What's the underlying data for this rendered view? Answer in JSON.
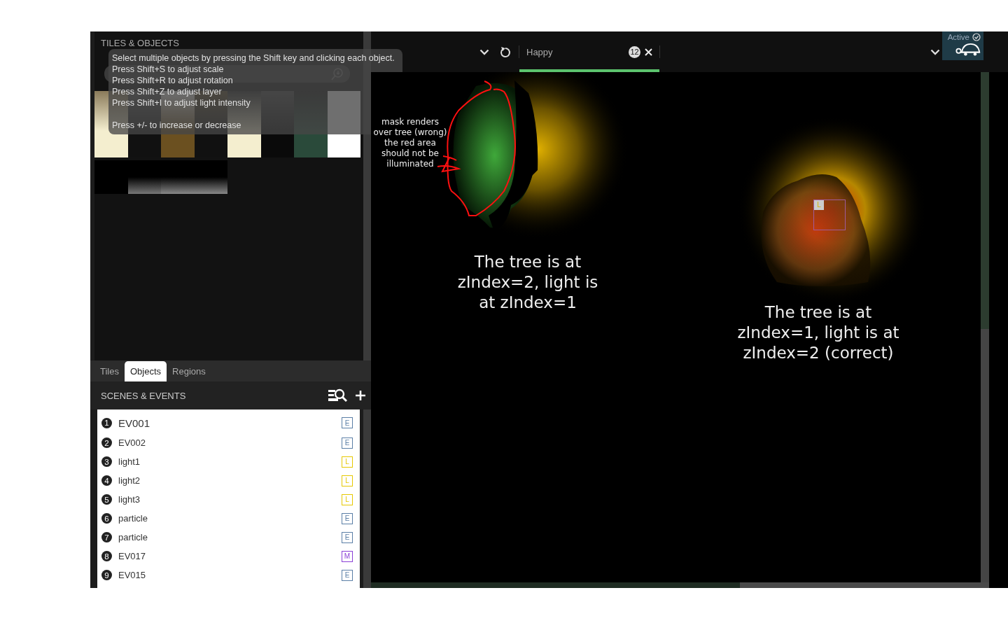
{
  "left_panel": {
    "title": "TILES & OBJECTS",
    "tooltip": {
      "lines": [
        "Select multiple objects by pressing the Shift key and clicking each object.",
        "Press Shift+S to adjust scale",
        "Press Shift+R to adjust rotation",
        "Press Shift+Z to adjust layer",
        "Press Shift+I to adjust light intensity"
      ],
      "footer": "Press +/- to increase or decrease"
    },
    "tabs": [
      {
        "label": "Tiles",
        "selected": false
      },
      {
        "label": "Objects",
        "selected": true
      },
      {
        "label": "Regions",
        "selected": false
      }
    ],
    "scenes": {
      "title": "SCENES & EVENTS",
      "items": [
        {
          "number": "1",
          "name": "EV001",
          "type": "E",
          "color": "#5b7fa6",
          "selected": true
        },
        {
          "number": "2",
          "name": "EV002",
          "type": "E",
          "color": "#5b7fa6",
          "selected": false
        },
        {
          "number": "3",
          "name": "light1",
          "type": "L",
          "color": "#e6c800",
          "selected": false
        },
        {
          "number": "4",
          "name": "light2",
          "type": "L",
          "color": "#e6c800",
          "selected": false
        },
        {
          "number": "5",
          "name": "light3",
          "type": "L",
          "color": "#e6c800",
          "selected": false
        },
        {
          "number": "6",
          "name": "particle",
          "type": "E",
          "color": "#5b7fa6",
          "selected": false
        },
        {
          "number": "7",
          "name": "particle",
          "type": "E",
          "color": "#5b7fa6",
          "selected": false
        },
        {
          "number": "8",
          "name": "EV017",
          "type": "M",
          "color": "#8a3fd6",
          "selected": false
        },
        {
          "number": "9",
          "name": "EV015",
          "type": "E",
          "color": "#5b7fa6",
          "selected": false
        }
      ]
    }
  },
  "top_bar": {
    "tab": {
      "label": "Happy",
      "count": "12",
      "selected": true
    },
    "status": "Active"
  },
  "canvas": {
    "note": "mask renders over tree (wrong) the red area should not be illuminated",
    "caption_left": "The tree is at zIndex=2, light is at zIndex=1",
    "caption_right": "The tree is at zIndex=1, light is at zIndex=2 (correct)",
    "marker": "L"
  }
}
